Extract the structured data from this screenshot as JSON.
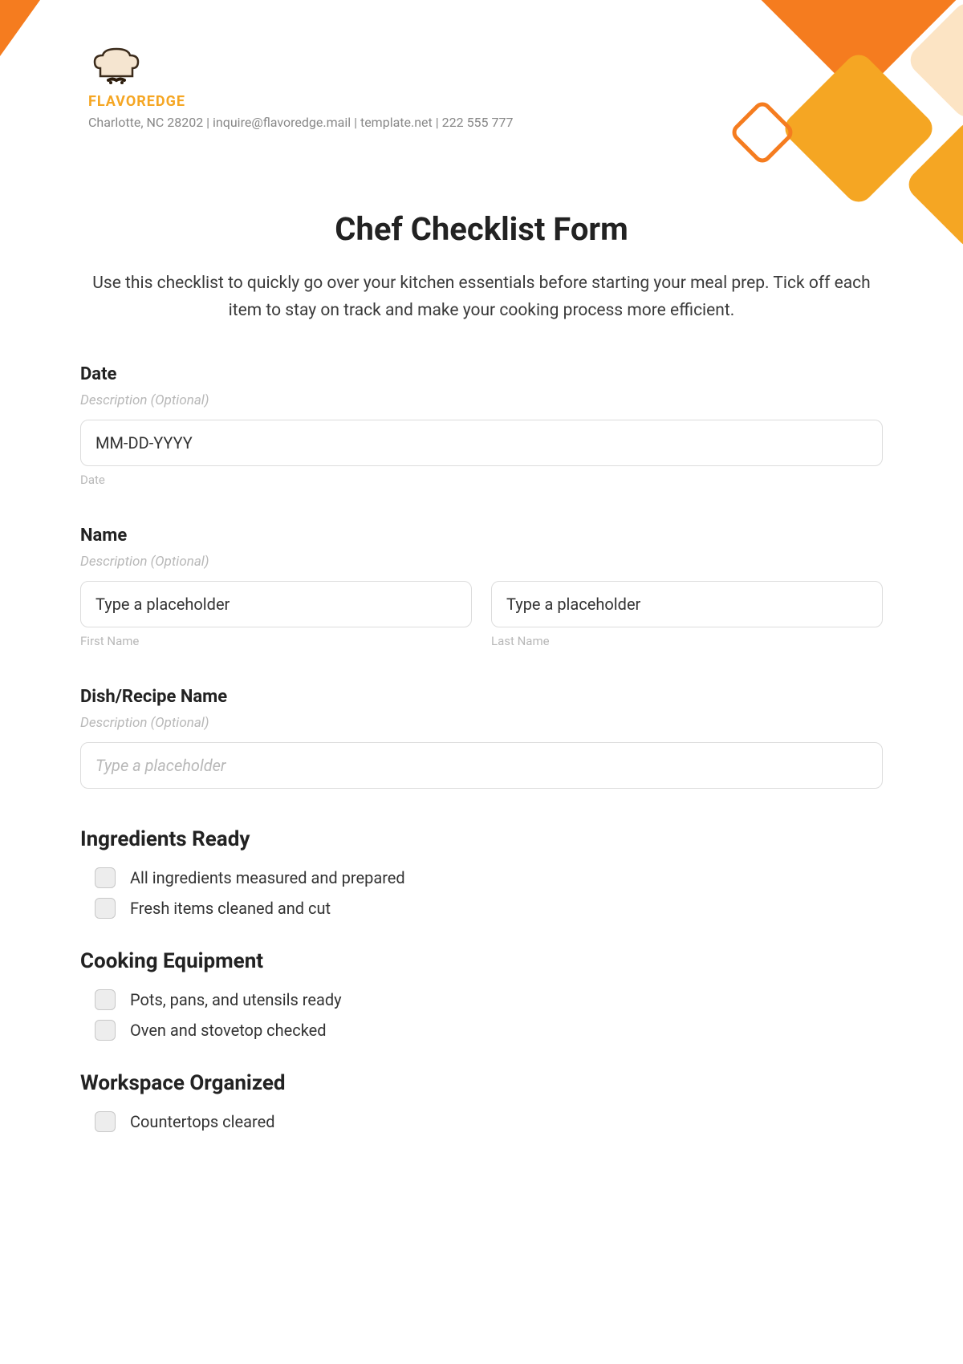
{
  "brand": {
    "name": "FLAVOREDGE",
    "contact": "Charlotte, NC 28202 | inquire@flavoredge.mail | template.net | 222 555 777"
  },
  "title": "Chef Checklist Form",
  "intro": "Use this checklist to quickly go over your kitchen essentials before starting your meal prep. Tick off each item to stay on track and make your cooking process more efficient.",
  "fields": {
    "date": {
      "label": "Date",
      "description": "Description (Optional)",
      "placeholder": "MM-DD-YYYY",
      "sub": "Date"
    },
    "name": {
      "label": "Name",
      "description": "Description (Optional)",
      "first_placeholder": "Type a placeholder",
      "last_placeholder": "Type a placeholder",
      "first_sub": "First Name",
      "last_sub": "Last Name"
    },
    "dish": {
      "label": "Dish/Recipe Name",
      "description": "Description (Optional)",
      "placeholder": "Type a placeholder"
    }
  },
  "sections": {
    "ingredients": {
      "heading": "Ingredients Ready",
      "items": [
        "All ingredients measured and prepared",
        "Fresh items cleaned and cut"
      ]
    },
    "equipment": {
      "heading": "Cooking Equipment",
      "items": [
        "Pots, pans, and utensils ready",
        "Oven and stovetop checked"
      ]
    },
    "workspace": {
      "heading": "Workspace Organized",
      "items": [
        "Countertops cleared"
      ]
    }
  }
}
